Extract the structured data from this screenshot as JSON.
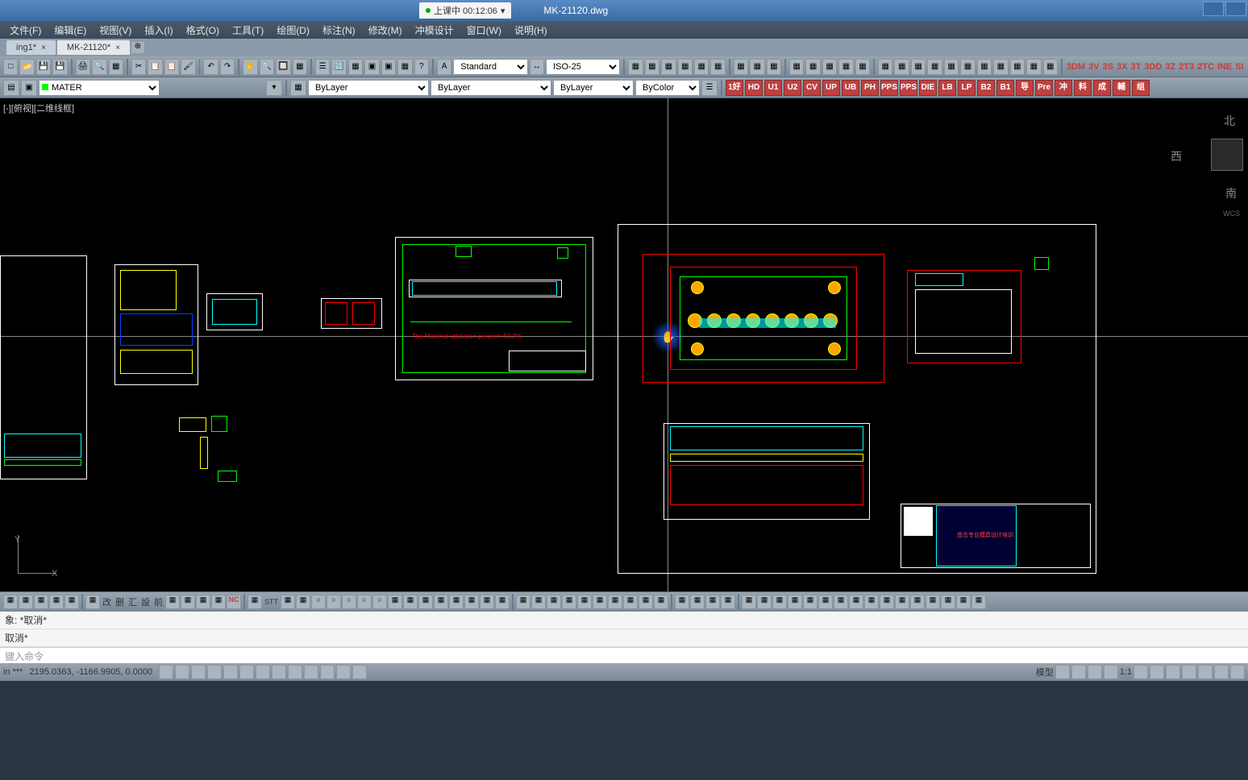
{
  "title": {
    "session_label": "上课中 00:12:06",
    "filename": "MK-21120.dwg"
  },
  "menu": {
    "file": "文件(F)",
    "edit": "编辑(E)",
    "view": "视图(V)",
    "insert": "插入(I)",
    "format": "格式(O)",
    "tools": "工具(T)",
    "draw": "绘图(D)",
    "dimension": "标注(N)",
    "modify": "修改(M)",
    "die_design": "冲模设计",
    "window": "窗口(W)",
    "help": "说明(H)"
  },
  "tabs": {
    "tab1": "ing1*",
    "tab2": "MK-21120*"
  },
  "toolbar1": {
    "style": "Standard",
    "dim_style": "ISO-25"
  },
  "toolbar2": {
    "layer": "MATER",
    "linetype1": "ByLayer",
    "linetype2": "ByLayer",
    "linetype3": "ByLayer",
    "color": "ByColor"
  },
  "red_labels": {
    "l1": "1好",
    "l2": "HD",
    "l3": "U1",
    "l4": "U2",
    "l5": "CV",
    "l6": "UP",
    "l7": "UB",
    "l8": "PH",
    "l9": "PPS",
    "l10": "PPS",
    "l11": "DIE",
    "l12": "LB",
    "l13": "LP",
    "l14": "B2",
    "l15": "B1",
    "l16": "导",
    "l17": "Pre",
    "l18": "冲",
    "l19": "料",
    "l20": "成",
    "l21": "輔",
    "l22": "组"
  },
  "red_txt": {
    "t1": "3DM",
    "t2": "3V",
    "t3": "3S",
    "t4": "3X",
    "t5": "3T",
    "t6": "3DD",
    "t7": "3Z",
    "t8": "2T3",
    "t9": "2TC",
    "t10": "INE",
    "t11": "SI"
  },
  "canvas": {
    "view_label": "[-][俯视][二维线框]",
    "utilization_text": "The Material utilization percent :50.2%",
    "viewcube": {
      "n": "北",
      "w": "西",
      "s": "南",
      "wcs": "WCS"
    },
    "ucs": {
      "x": "X",
      "y": "Y"
    }
  },
  "bottom_tb": {
    "gai": "改",
    "shan": "删",
    "hui": "汇",
    "she": "設",
    "qian": "前",
    "stt": "STT"
  },
  "command": {
    "line1": "象: *取消*",
    "line2": "取消*",
    "prompt": "键入命令"
  },
  "status": {
    "prefix": "in ***",
    "coords": "2195.0363, -1166.9905, 0.0000",
    "model": "模型",
    "scale": "1:1"
  }
}
